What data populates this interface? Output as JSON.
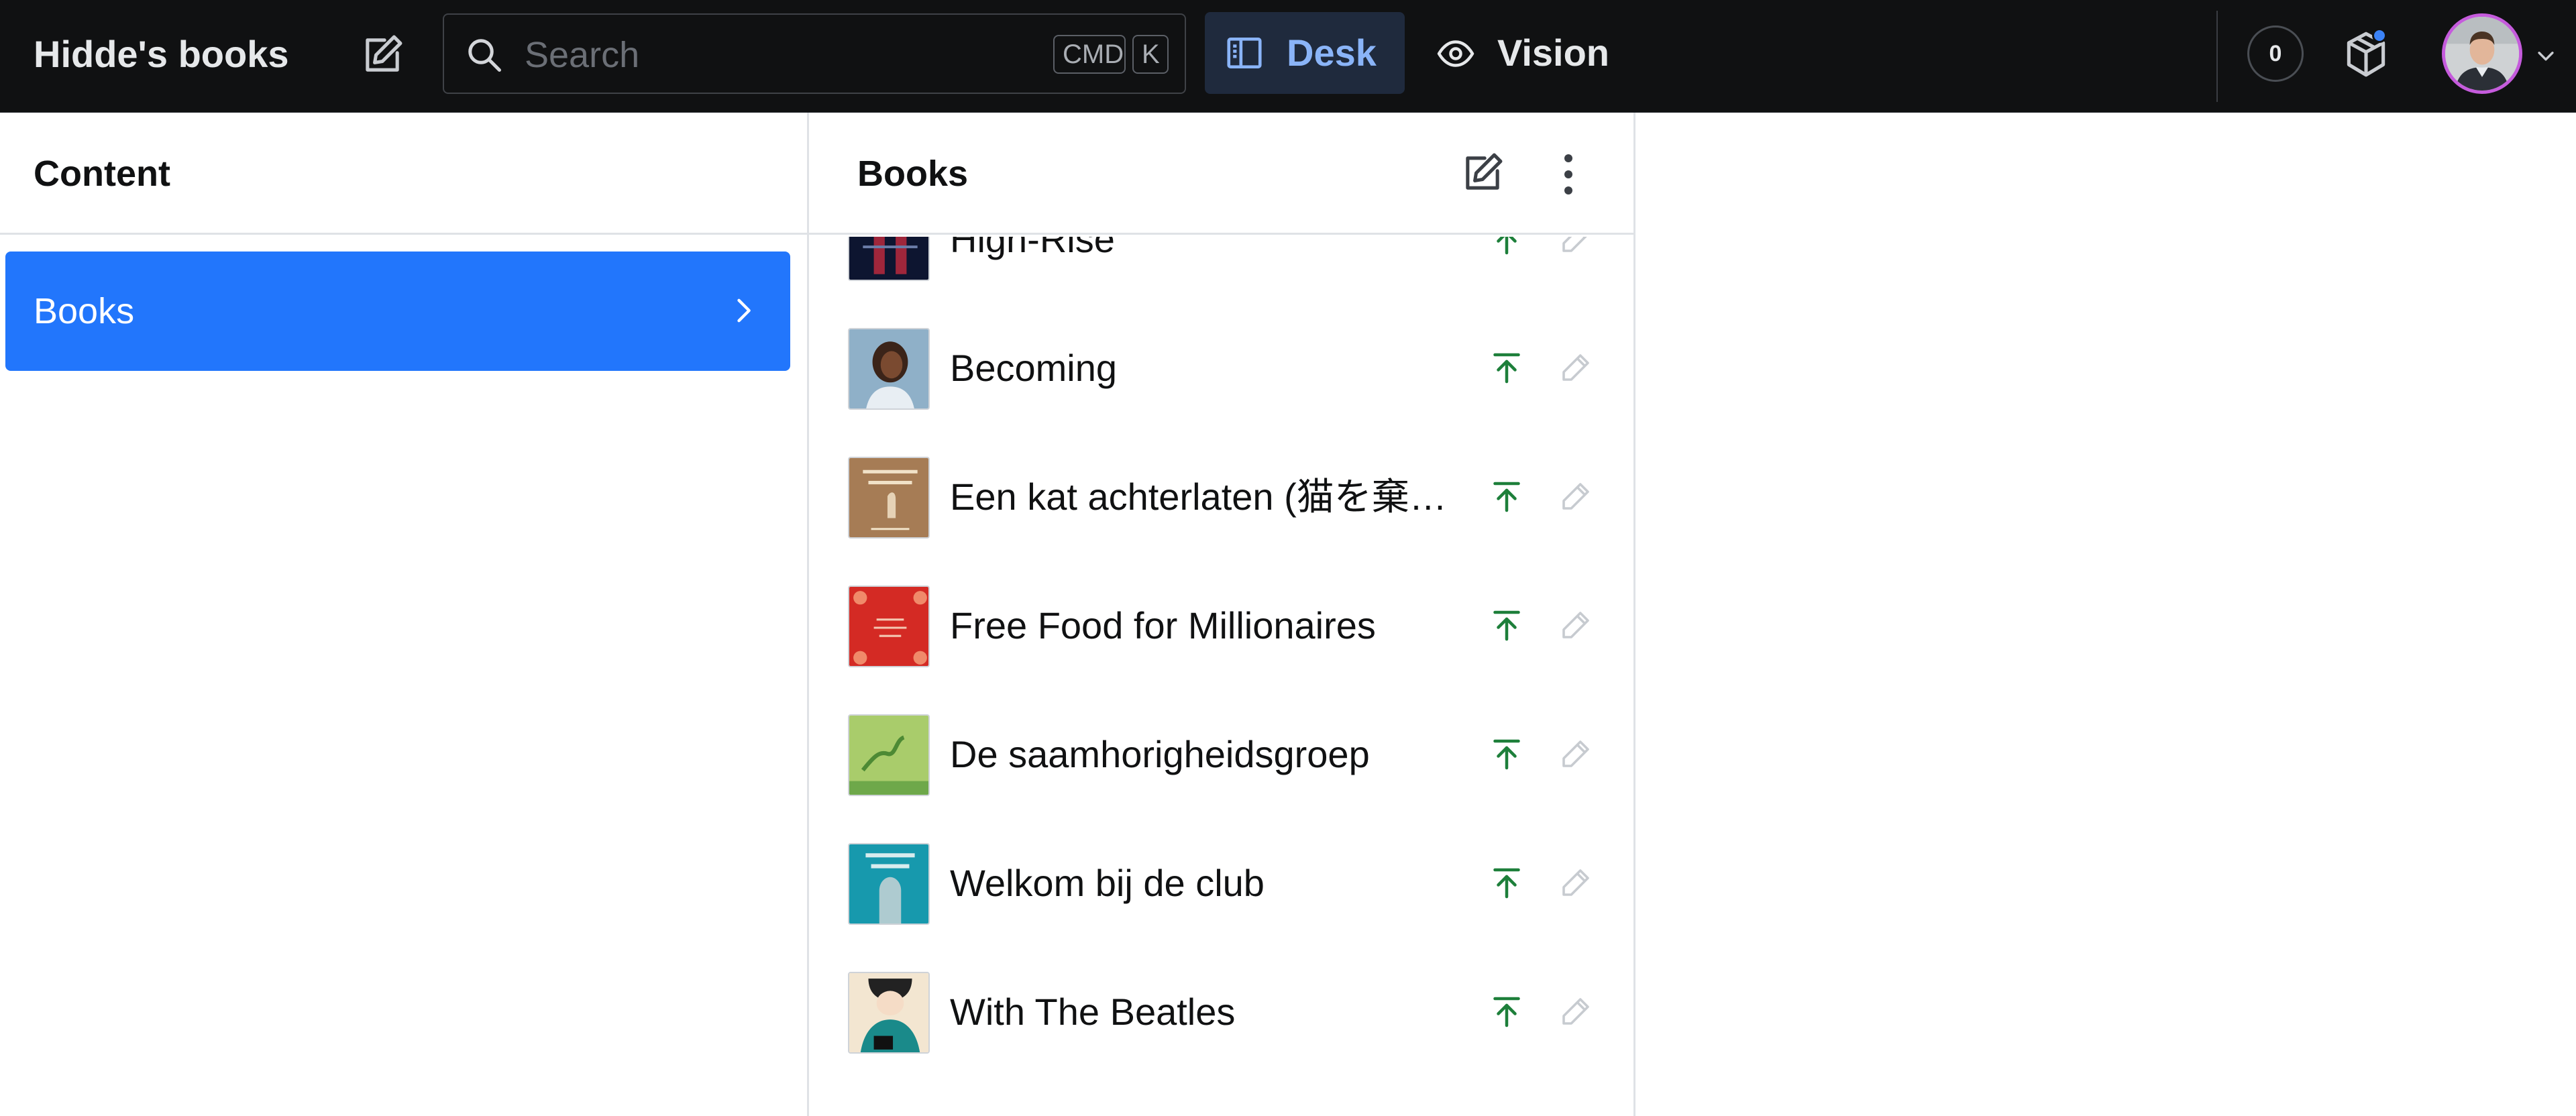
{
  "navbar": {
    "project_title": "Hidde's books",
    "search": {
      "placeholder": "Search",
      "shortcut_cmd": "CMD",
      "shortcut_key": "K"
    },
    "tools": [
      {
        "label": "Desk",
        "icon": "desk-icon",
        "active": true
      },
      {
        "label": "Vision",
        "icon": "eye-icon",
        "active": false
      }
    ],
    "counter": "0",
    "accent_color": "#2276fc"
  },
  "content_pane": {
    "title": "Content",
    "items": [
      {
        "label": "Books",
        "selected": true
      }
    ]
  },
  "books_pane": {
    "title": "Books",
    "books": [
      {
        "title": "High-Rise",
        "cover_colors": [
          "#0d1530",
          "#c42a3f"
        ]
      },
      {
        "title": "Becoming",
        "cover_colors": [
          "#8fb0c8",
          "#4a3326"
        ]
      },
      {
        "title": "Een kat achterlaten (猫を棄てる)",
        "cover_colors": [
          "#a67c55",
          "#f1e2c8"
        ]
      },
      {
        "title": "Free Food for Millionaires",
        "cover_colors": [
          "#d42a24",
          "#f4c7b2"
        ]
      },
      {
        "title": "De saamhorigheidsgroep",
        "cover_colors": [
          "#a9cc6b",
          "#4d8a34"
        ]
      },
      {
        "title": "Welkom bij de club",
        "cover_colors": [
          "#1799ad",
          "#d8ecee"
        ]
      },
      {
        "title": "With The Beatles",
        "cover_colors": [
          "#f3e6d1",
          "#1a8a8a"
        ]
      }
    ],
    "publish_color": "#1d7f3a"
  }
}
